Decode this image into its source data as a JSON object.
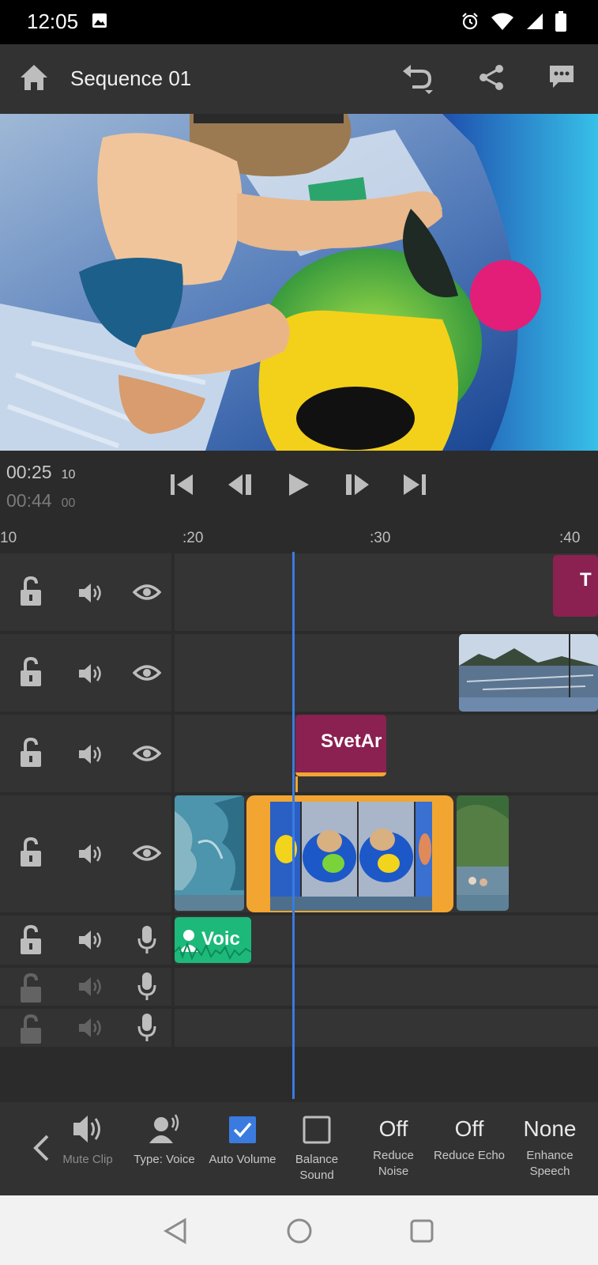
{
  "status": {
    "time": "12:05"
  },
  "header": {
    "title": "Sequence 01"
  },
  "transport": {
    "current_time": "00:25",
    "current_frames": "10",
    "duration_time": "00:44",
    "duration_frames": "00"
  },
  "ruler": {
    "ticks": [
      "10",
      ":20",
      ":30",
      ":40"
    ]
  },
  "clips": {
    "title_top": "T",
    "title_mid": "SvetAr",
    "voice": "Voic"
  },
  "toolbar": {
    "mute_clip": "Mute Clip",
    "type_voice": "Type: Voice",
    "auto_volume": "Auto Volume",
    "balance_sound": "Balance Sound",
    "reduce_noise_value": "Off",
    "reduce_noise": "Reduce Noise",
    "reduce_echo_value": "Off",
    "reduce_echo": "Reduce Echo",
    "enhance_speech_value": "None",
    "enhance_speech": "Enhance Speech"
  },
  "colors": {
    "accent_blue": "#3a7be0",
    "title_clip": "#8b2150",
    "selected_clip": "#f2a531",
    "voice_clip": "#1db97a"
  }
}
